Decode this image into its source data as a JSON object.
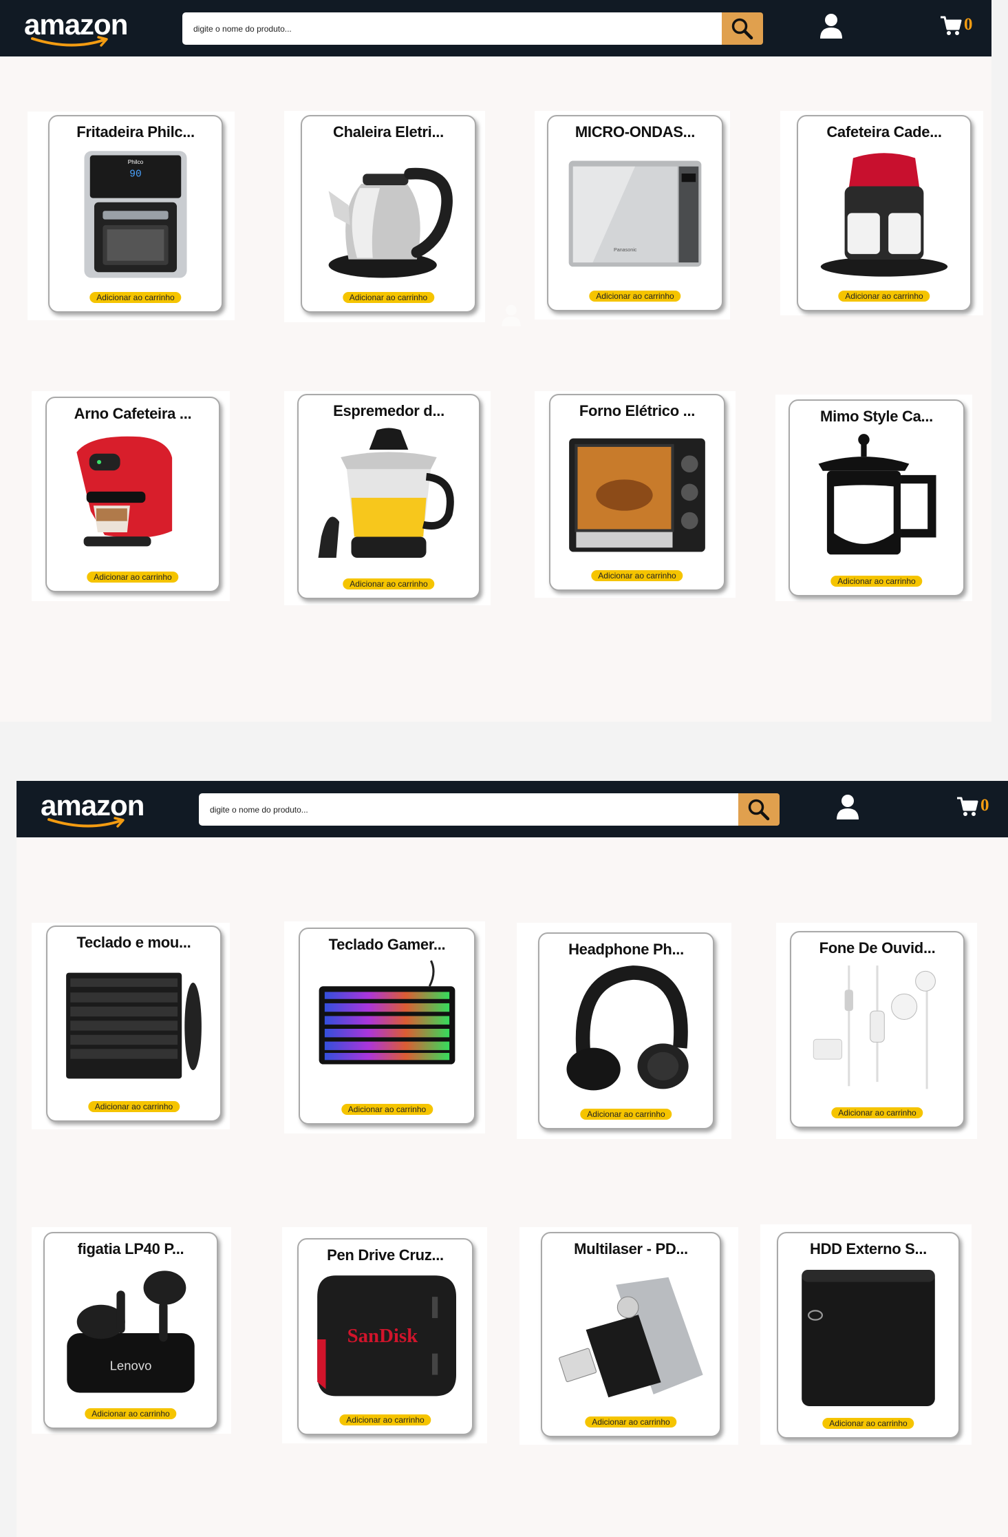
{
  "header": {
    "logo": "amazon",
    "search_placeholder": "digite o nome do produto...",
    "search_icon": "search-icon",
    "user_icon": "user-icon",
    "cart_icon": "cart-icon",
    "cart_count": "0"
  },
  "colors": {
    "topbar": "#111a24",
    "search_button": "#e0a04e",
    "add_button": "#f5c400",
    "cart_count": "#f39c12",
    "page_background": "#faf7f6"
  },
  "add_label": "Adicionar ao carrinho",
  "screen1": {
    "products": [
      {
        "title": "Fritadeira Philc...",
        "image": "air-fryer-image"
      },
      {
        "title": "Chaleira Eletri...",
        "image": "electric-kettle-image"
      },
      {
        "title": "MICRO-ONDAS...",
        "image": "microwave-image"
      },
      {
        "title": "Cafeteira Cade...",
        "image": "coffee-maker-image"
      },
      {
        "title": "Arno Cafeteira ...",
        "image": "capsule-coffee-machine-image"
      },
      {
        "title": "Espremedor d...",
        "image": "juicer-image"
      },
      {
        "title": "Forno Elétrico ...",
        "image": "electric-oven-image"
      },
      {
        "title": "Mimo Style Ca...",
        "image": "french-press-image"
      }
    ]
  },
  "screen2": {
    "products": [
      {
        "title": "Teclado e mou...",
        "image": "keyboard-mouse-image"
      },
      {
        "title": "Teclado Gamer...",
        "image": "gaming-keyboard-image"
      },
      {
        "title": "Headphone Ph...",
        "image": "headphone-image"
      },
      {
        "title": "Fone De Ouvid...",
        "image": "earphones-image"
      },
      {
        "title": "figatia LP40 P...",
        "image": "wireless-earbuds-image"
      },
      {
        "title": "Pen Drive Cruz...",
        "image": "pen-drive-image"
      },
      {
        "title": "Multilaser - PD...",
        "image": "usb-drive-image"
      },
      {
        "title": "HDD Externo S...",
        "image": "external-hdd-image"
      }
    ]
  }
}
